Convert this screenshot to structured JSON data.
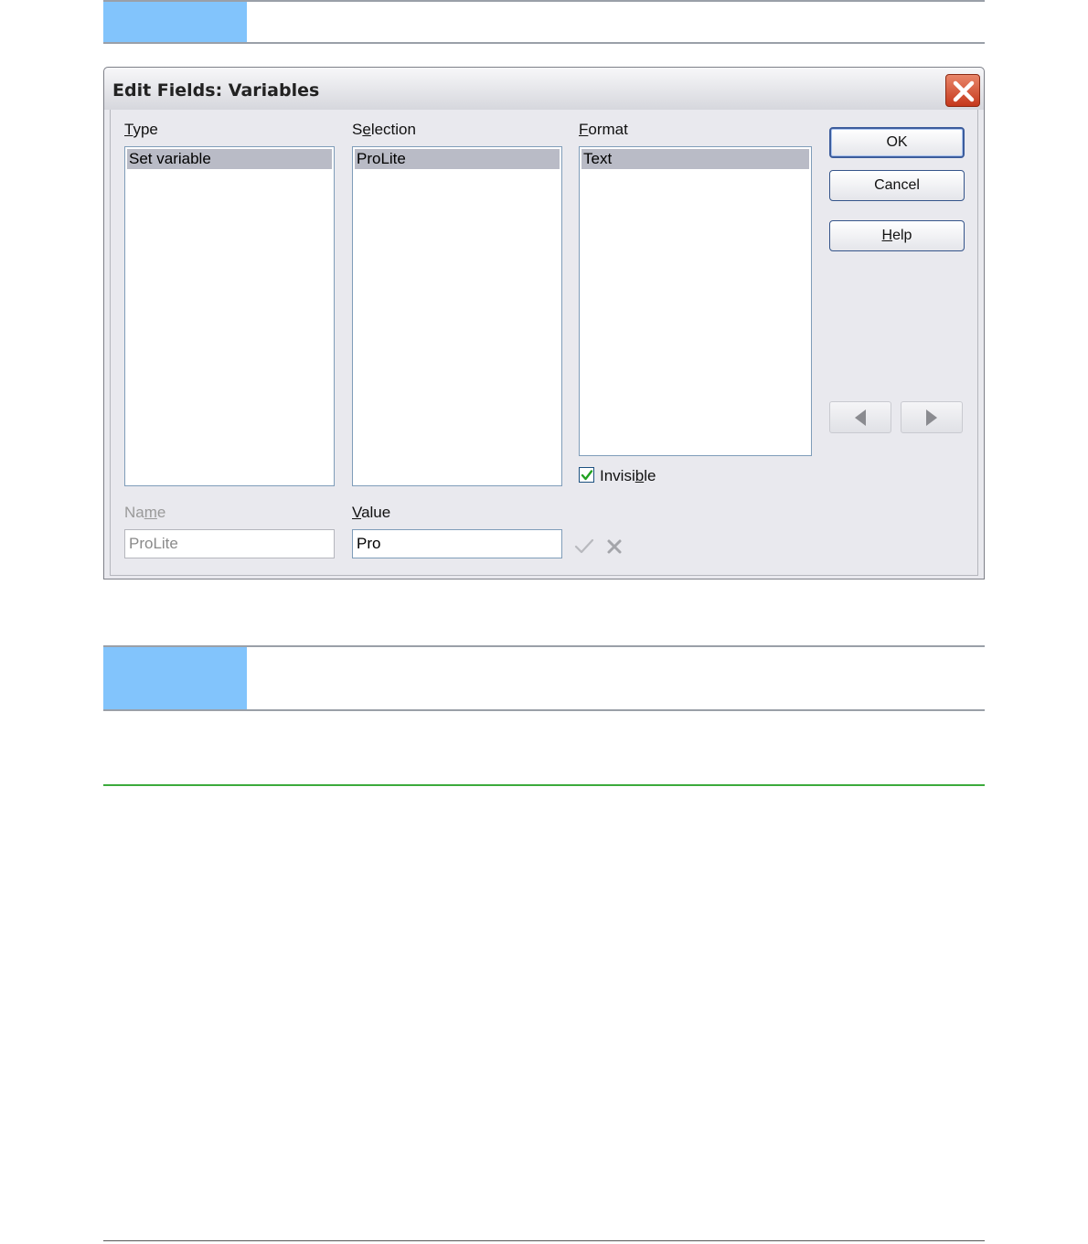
{
  "dialog": {
    "title": "Edit Fields: Variables",
    "columns": {
      "type": {
        "label_u": "T",
        "label_rest": "ype",
        "selected_item": "Set variable"
      },
      "selection": {
        "label_pre": "S",
        "label_u": "e",
        "label_rest": "lection",
        "selected_item": "ProLite"
      },
      "format": {
        "label_u": "F",
        "label_rest": "ormat",
        "selected_item": "Text"
      }
    },
    "buttons": {
      "ok": "OK",
      "cancel": "Cancel",
      "help_u": "H",
      "help_rest": "elp"
    },
    "invisible": {
      "pre": "Invisi",
      "u": "b",
      "rest": "le",
      "checked": true
    },
    "name_field": {
      "pre": "Na",
      "u": "m",
      "rest": "e",
      "value": "ProLite"
    },
    "value_field": {
      "u": "V",
      "rest": "alue",
      "value": "Pro"
    },
    "icons": {
      "close": "close-icon",
      "prev": "arrow-left-icon",
      "next": "arrow-right-icon",
      "apply": "checkmark-icon",
      "delete": "delete-x-icon"
    }
  }
}
